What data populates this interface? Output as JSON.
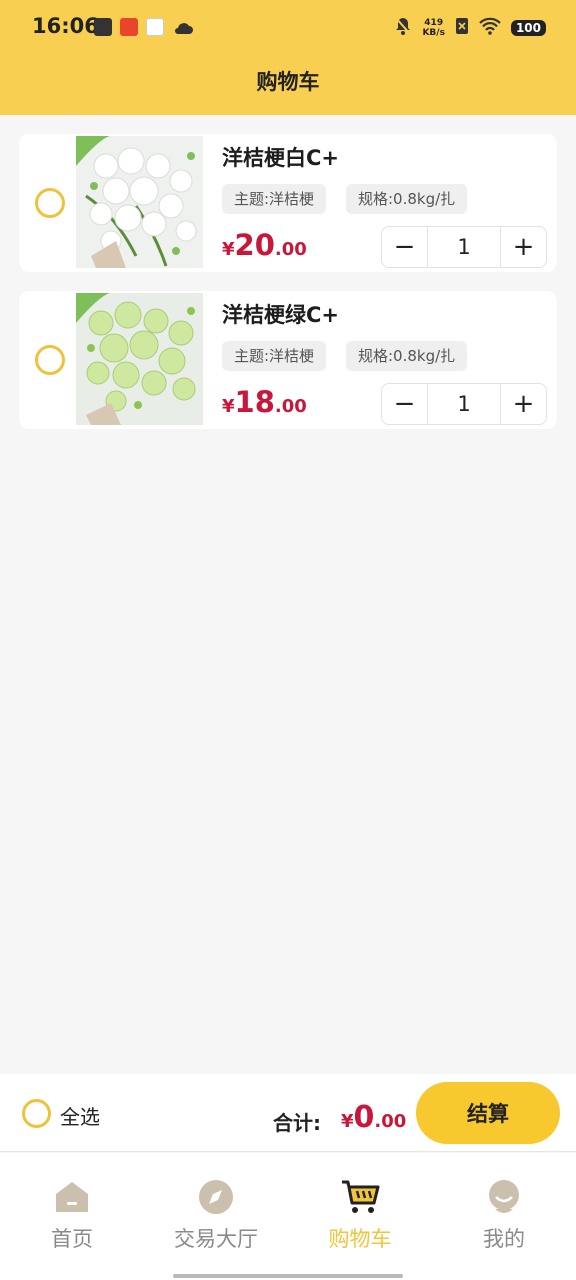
{
  "status_bar": {
    "time": "16:06",
    "net_speed_value": "419",
    "net_speed_unit": "KB/s",
    "battery": "100"
  },
  "header": {
    "title": "购物车"
  },
  "cart": {
    "items": [
      {
        "name": "洋桔梗白C+",
        "theme_tag": "主题:洋桔梗",
        "spec_tag": "规格:0.8kg/扎",
        "price_symbol": "¥",
        "price_int": "20",
        "price_dec": ".00",
        "quantity": "1",
        "minus_label": "−",
        "plus_label": "+",
        "checked": false,
        "flower_color": "#ffffff"
      },
      {
        "name": "洋桔梗绿C+",
        "theme_tag": "主题:洋桔梗",
        "spec_tag": "规格:0.8kg/扎",
        "price_symbol": "¥",
        "price_int": "18",
        "price_dec": ".00",
        "quantity": "1",
        "minus_label": "−",
        "plus_label": "+",
        "checked": false,
        "flower_color": "#cfe8a0"
      }
    ]
  },
  "footer": {
    "select_all_label": "全选",
    "total_label": "合计:",
    "total_symbol": "¥",
    "total_int": "0",
    "total_dec": ".00",
    "checkout_label": "结算"
  },
  "tabbar": {
    "tabs": [
      {
        "label": "首页",
        "icon": "home-icon",
        "active": false
      },
      {
        "label": "交易大厅",
        "icon": "compass-icon",
        "active": false
      },
      {
        "label": "购物车",
        "icon": "cart-icon",
        "active": true
      },
      {
        "label": "我的",
        "icon": "profile-icon",
        "active": false
      }
    ]
  },
  "colors": {
    "brand_yellow": "#f9cf52",
    "accent_button": "#f7c92e",
    "price_red": "#c8173a",
    "active_tab": "#f2c43b",
    "inactive_tab": "#8a8a8a"
  }
}
